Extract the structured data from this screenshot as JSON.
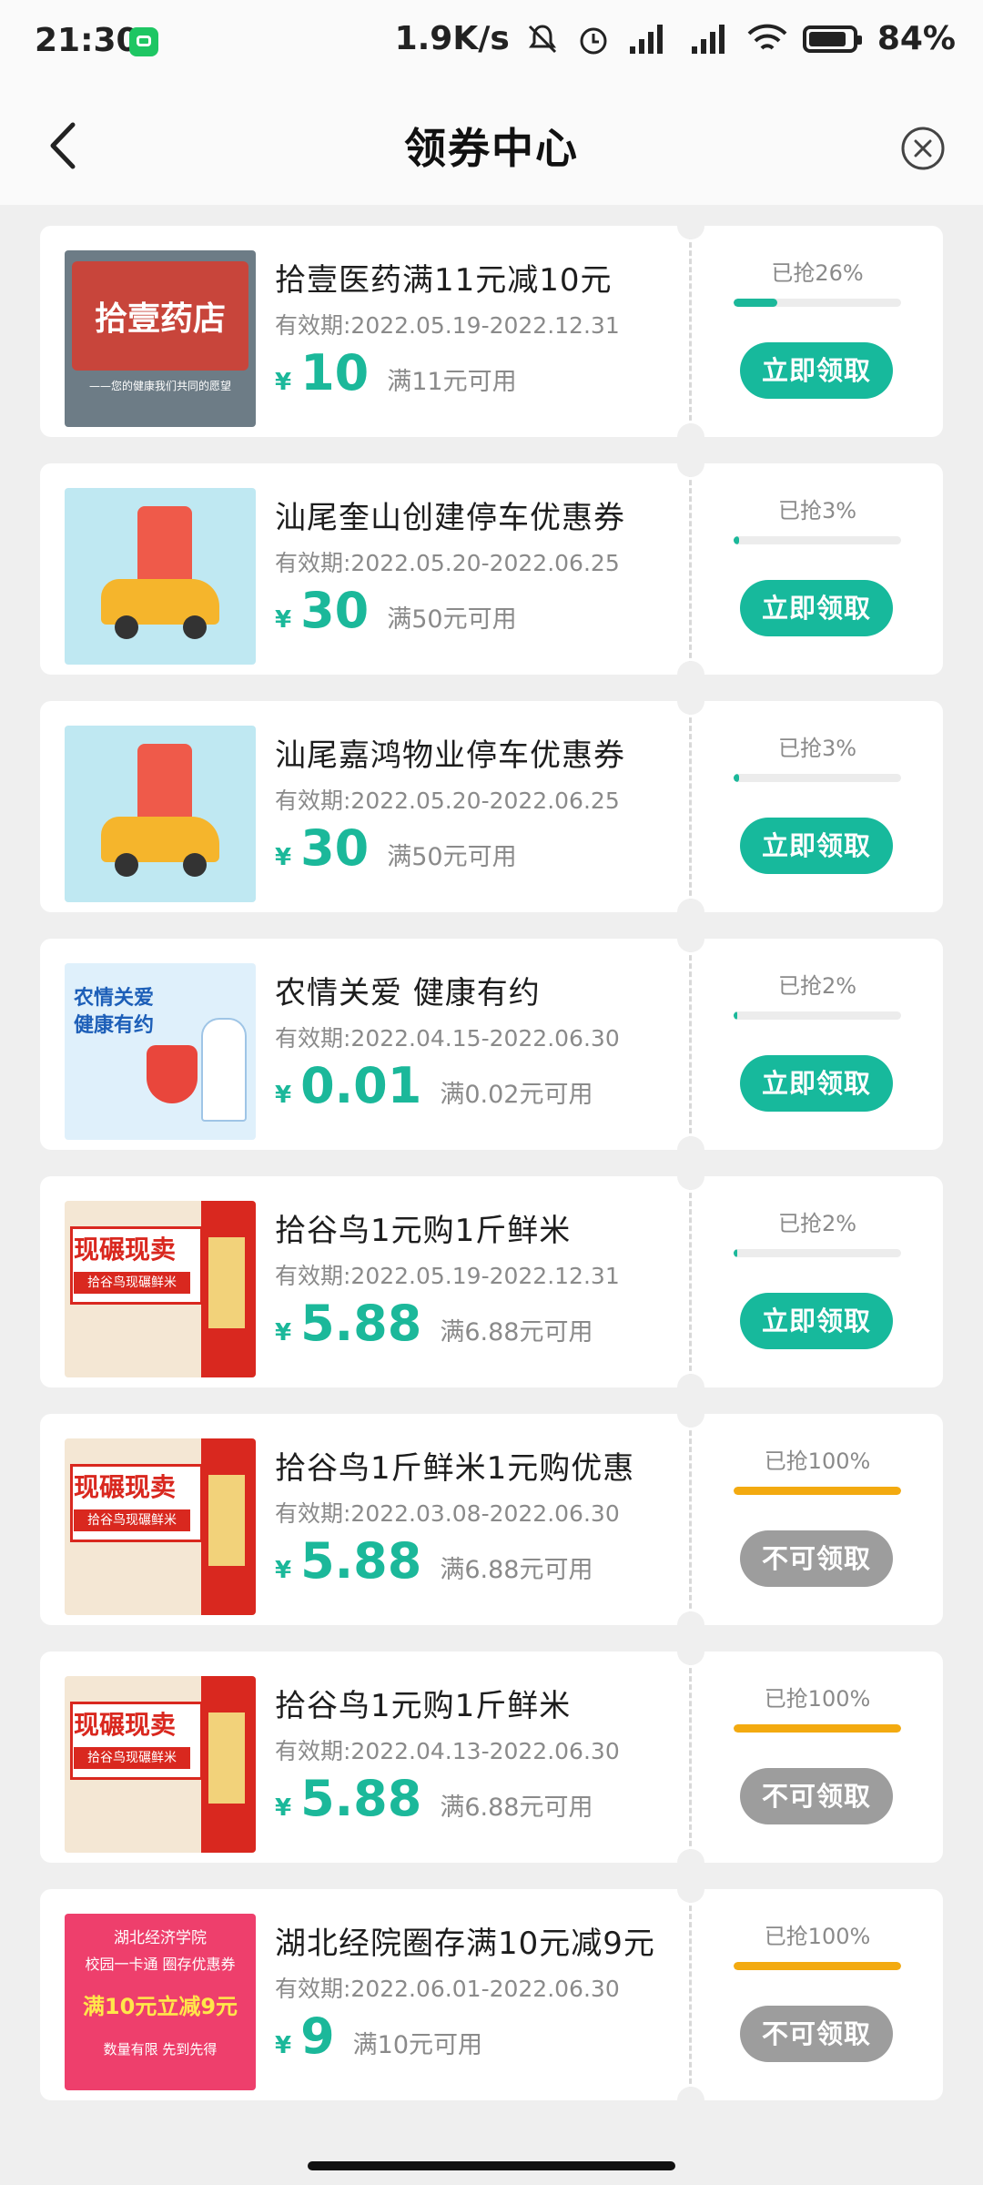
{
  "status_bar": {
    "time": "21:30",
    "speed": "1.9K/s",
    "battery": "84"
  },
  "header": {
    "title": "领券中心"
  },
  "coupons": [
    {
      "title": "拾壹医药满11元减10元",
      "validity": "有效期:2022.05.19-2022.12.31",
      "yen": "¥",
      "amount": "10",
      "condition": "满11元可用",
      "grab": "已抢26%",
      "progress": 0.26,
      "button": "立即领取",
      "available": true,
      "thumb": {
        "type": "store",
        "lines": [
          "拾壹药店",
          "——您的健康我们共同的愿望"
        ]
      }
    },
    {
      "title": "汕尾奎山创建停车优惠券",
      "validity": "有效期:2022.05.20-2022.06.25",
      "yen": "¥",
      "amount": "30",
      "condition": "满50元可用",
      "grab": "已抢3%",
      "progress": 0.03,
      "button": "立即领取",
      "available": true,
      "thumb": {
        "type": "car",
        "lines": []
      }
    },
    {
      "title": "汕尾嘉鸿物业停车优惠券",
      "validity": "有效期:2022.05.20-2022.06.25",
      "yen": "¥",
      "amount": "30",
      "condition": "满50元可用",
      "grab": "已抢3%",
      "progress": 0.03,
      "button": "立即领取",
      "available": true,
      "thumb": {
        "type": "car",
        "lines": []
      }
    },
    {
      "title": "农情关爱 健康有约",
      "validity": "有效期:2022.04.15-2022.06.30",
      "yen": "¥",
      "amount": "0.01",
      "condition": "满0.02元可用",
      "grab": "已抢2%",
      "progress": 0.02,
      "button": "立即领取",
      "available": true,
      "thumb": {
        "type": "health",
        "lines": [
          "农情关爱",
          "健康有约"
        ]
      }
    },
    {
      "title": "拾谷鸟1元购1斤鲜米",
      "validity": "有效期:2022.05.19-2022.12.31",
      "yen": "¥",
      "amount": "5.88",
      "condition": "满6.88元可用",
      "grab": "已抢2%",
      "progress": 0.02,
      "button": "立即领取",
      "available": true,
      "thumb": {
        "type": "rice",
        "lines": [
          "现碾现卖",
          "拾谷鸟现碾鲜米"
        ]
      }
    },
    {
      "title": "拾谷鸟1斤鲜米1元购优惠",
      "validity": "有效期:2022.03.08-2022.06.30",
      "yen": "¥",
      "amount": "5.88",
      "condition": "满6.88元可用",
      "grab": "已抢100%",
      "progress": 1.0,
      "button": "不可领取",
      "available": false,
      "thumb": {
        "type": "rice",
        "lines": [
          "现碾现卖",
          "拾谷鸟现碾鲜米"
        ]
      }
    },
    {
      "title": "拾谷鸟1元购1斤鲜米",
      "validity": "有效期:2022.04.13-2022.06.30",
      "yen": "¥",
      "amount": "5.88",
      "condition": "满6.88元可用",
      "grab": "已抢100%",
      "progress": 1.0,
      "button": "不可领取",
      "available": false,
      "thumb": {
        "type": "rice",
        "lines": [
          "现碾现卖",
          "拾谷鸟现碾鲜米"
        ]
      }
    },
    {
      "title": "湖北经院圈存满10元减9元",
      "validity": "有效期:2022.06.01-2022.06.30",
      "yen": "¥",
      "amount": "9",
      "condition": "满10元可用",
      "grab": "已抢100%",
      "progress": 1.0,
      "button": "不可领取",
      "available": false,
      "thumb": {
        "type": "pink",
        "lines": [
          "湖北经济学院",
          "校园一卡通 圈存优惠券",
          "满10元立减9元",
          "数量有限 先到先得"
        ]
      }
    }
  ]
}
